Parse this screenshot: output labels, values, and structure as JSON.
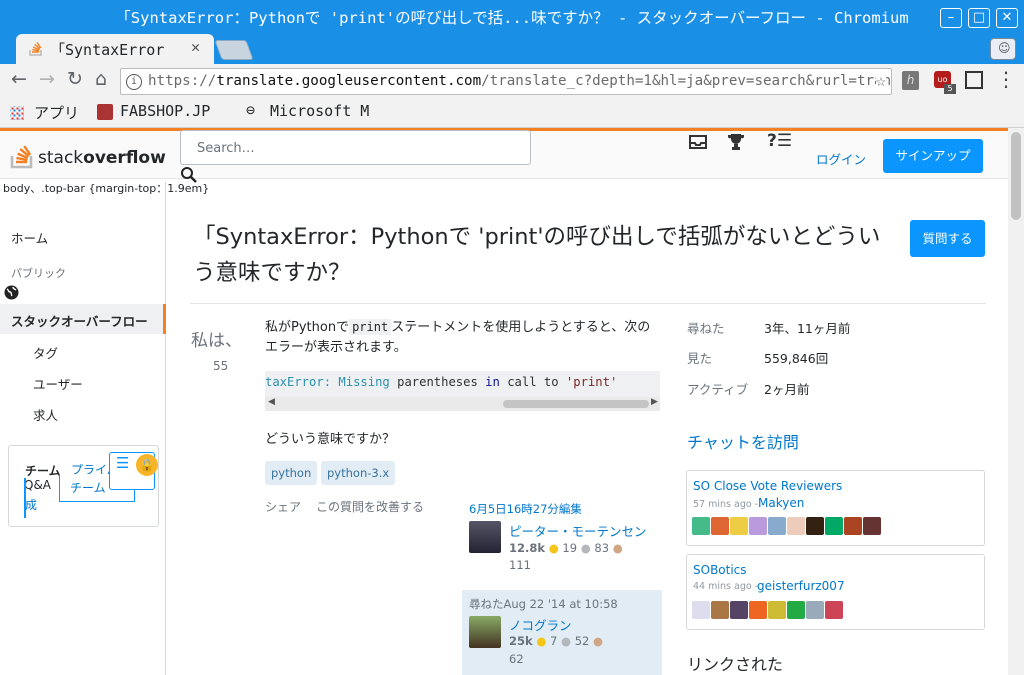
{
  "window": {
    "title": "「SyntaxError：Pythonで 'print'の呼び出しで括...味ですか？ - スタックオーバーフロー - Chromium"
  },
  "tab": {
    "title": "「SyntaxError"
  },
  "address": {
    "scheme": "https://",
    "host": "translate.googleusercontent.com",
    "path": "/translate_c?depth=1&hl=ja&prev=search&rurl=trans..."
  },
  "extensions": {
    "badge": "5"
  },
  "bookmarks": [
    {
      "label": "アプリ"
    },
    {
      "label": "FABSHOP.JP"
    },
    {
      "label": "Microsoft M"
    }
  ],
  "site": {
    "logo": {
      "left": "stack",
      "right": "overflow"
    },
    "search_placeholder": "Search…",
    "login": "ログイン",
    "signup": "サインアップ",
    "debug_text": "body、.top-bar {margin-top：1.9em}"
  },
  "leftnav": {
    "home": "ホーム",
    "public": "パブリック",
    "so": "スタックオーバーフロー",
    "tags": "タグ",
    "users": "ユーザー",
    "jobs": "求人",
    "teams_title": "チーム",
    "teams_privacy": "プライバ",
    "teams_qa": "Q&A",
    "teams_create": "成",
    "teams_team": "チーム"
  },
  "question": {
    "title": "「SyntaxError：Pythonで 'print'の呼び出しで括弧がないとどういう意味ですか？",
    "ask_button": "質問する",
    "vote_label": "私は、",
    "vote_count": "55",
    "body_pre": "私がPythonで",
    "body_code": "print",
    "body_post": "ステートメントを使用しようとすると、次のエラーが表示されます。",
    "code": {
      "part1": "taxError:",
      "part2": "Missing",
      "part3": "parentheses",
      "part4": "in",
      "part5": "call to",
      "part6": "'print'"
    },
    "body2": "どういう意味ですか？",
    "tags": [
      "python",
      "python-3.x"
    ],
    "share": "シェア",
    "improve": "この質問を改善する",
    "edited": {
      "when": "6月5日16時27分編集",
      "user": "ピーター・モーテンセン",
      "rep": "12.8k",
      "gold": "19",
      "silver": "83",
      "bronze": "111"
    },
    "asked": {
      "when": "尋ねたAug 22 '14 at 10:58",
      "user": "ノコグラン",
      "rep": "25k",
      "gold": "7",
      "silver": "52",
      "bronze": "62"
    }
  },
  "sidebar": {
    "stats": [
      {
        "label": "尋ねた",
        "value": "3年、11ヶ月前"
      },
      {
        "label": "見た",
        "value": "559,846回"
      },
      {
        "label": "アクティブ",
        "value": "2ヶ月前"
      }
    ],
    "chat_heading": "チャットを訪問",
    "rooms": [
      {
        "name": "SO Close Vote Reviewers",
        "time": "57 mins ago -",
        "user": "Makyen"
      },
      {
        "name": "SOBotics",
        "time": "44 mins ago -",
        "user": "geisterfurz007"
      }
    ],
    "linked": "リンクされた"
  },
  "colors": {
    "titlebar": "#1a8fe6",
    "accent": "#f48024",
    "link": "#0077cc",
    "button": "#0a95ff"
  }
}
